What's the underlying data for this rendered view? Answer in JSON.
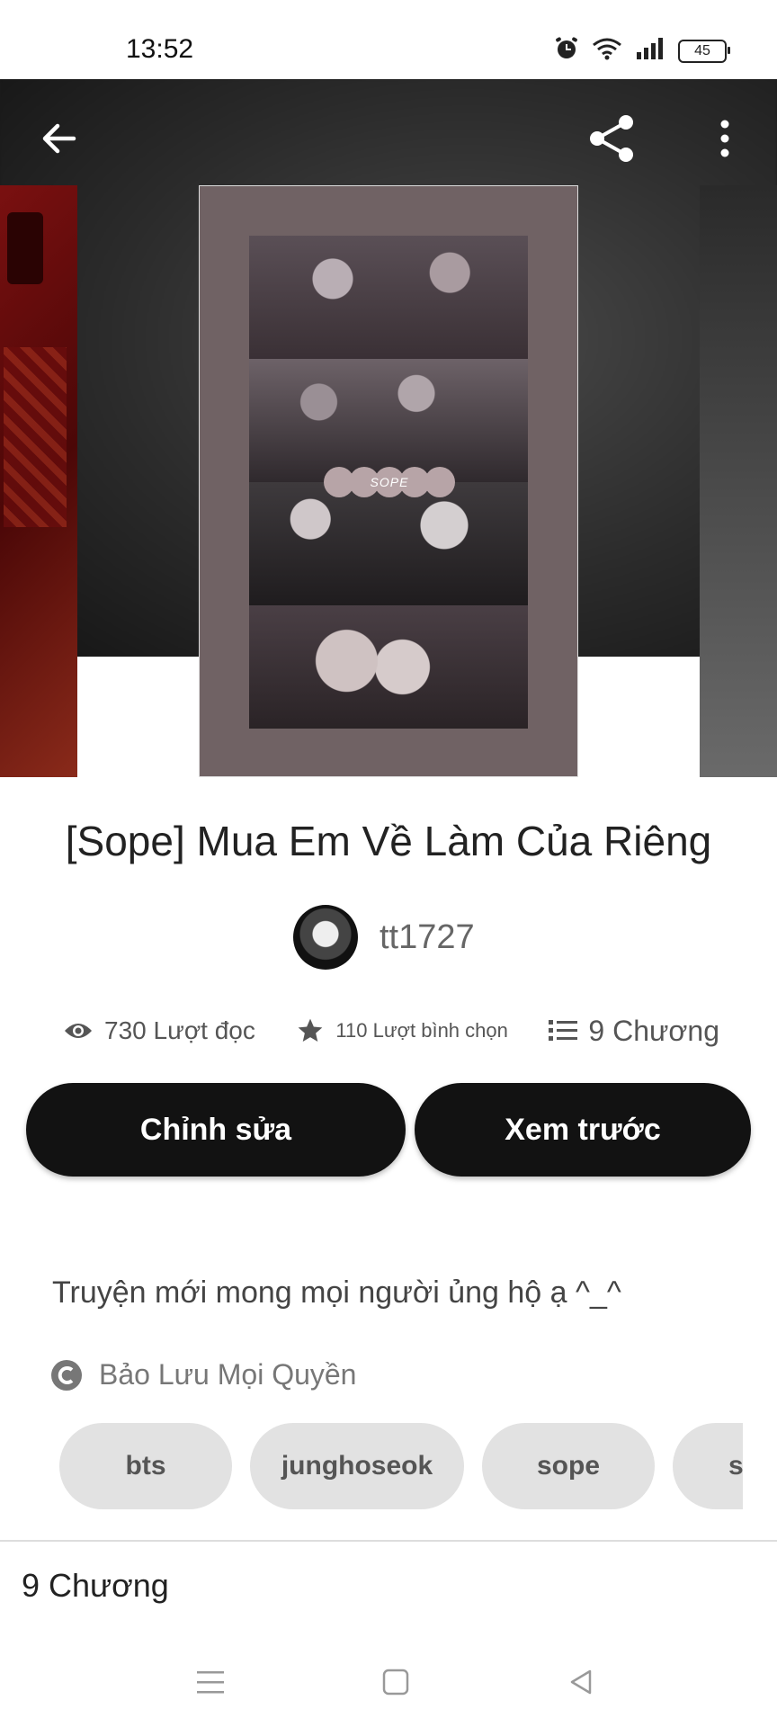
{
  "status_bar": {
    "time": "13:52",
    "battery": "45",
    "icons": [
      "alarm-icon",
      "wifi-icon",
      "signal-icon",
      "battery-icon"
    ]
  },
  "toolbar": {
    "icons": [
      "back-arrow-icon",
      "share-icon",
      "more-vertical-icon"
    ]
  },
  "cover": {
    "overlay_text": "SOPE"
  },
  "story": {
    "title": "[Sope] Mua Em Về Làm Của Riêng",
    "author": "tt1727",
    "reads": "730 Lượt đọc",
    "votes": "110 Lượt bình chọn",
    "chapters": "9 Chương",
    "description": "Truyện mới mong mọi người ủng hộ ạ ^_^",
    "copyright": "Bảo Lưu Mọi Quyền"
  },
  "actions": {
    "edit_label": "Chỉnh sửa",
    "preview_label": "Xem trước"
  },
  "tags": [
    "bts",
    "junghoseok",
    "sope",
    "s"
  ],
  "chapter_section": {
    "label": "9 Chương"
  },
  "navbar": {
    "icons": [
      "menu-icon",
      "home-square-icon",
      "back-triangle-icon"
    ]
  }
}
